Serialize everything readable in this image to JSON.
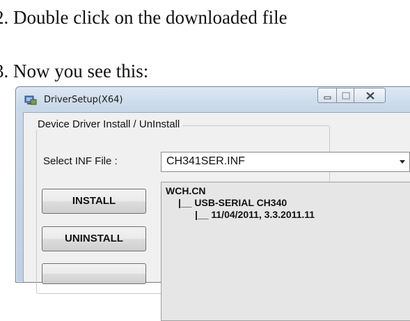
{
  "steps": [
    {
      "text": "2. Double click on the downloaded file"
    },
    {
      "text": "3. Now you see this:"
    }
  ],
  "window": {
    "title": "DriverSetup(X64)",
    "app_icon": "driver-setup-icon",
    "controls": [
      "minimize-icon",
      "maximize-icon",
      "close-icon"
    ]
  },
  "group": {
    "label": "Device Driver Install / UnInstall",
    "inf_label": "Select INF File :",
    "inf_value": "CH341SER.INF",
    "buttons": {
      "install": "INSTALL",
      "uninstall": "UNINSTALL",
      "help": ""
    },
    "info_lines": [
      "WCH.CN",
      "|__ USB-SERIAL CH340",
      "|__ 11/04/2011, 3.3.2011.11"
    ]
  }
}
